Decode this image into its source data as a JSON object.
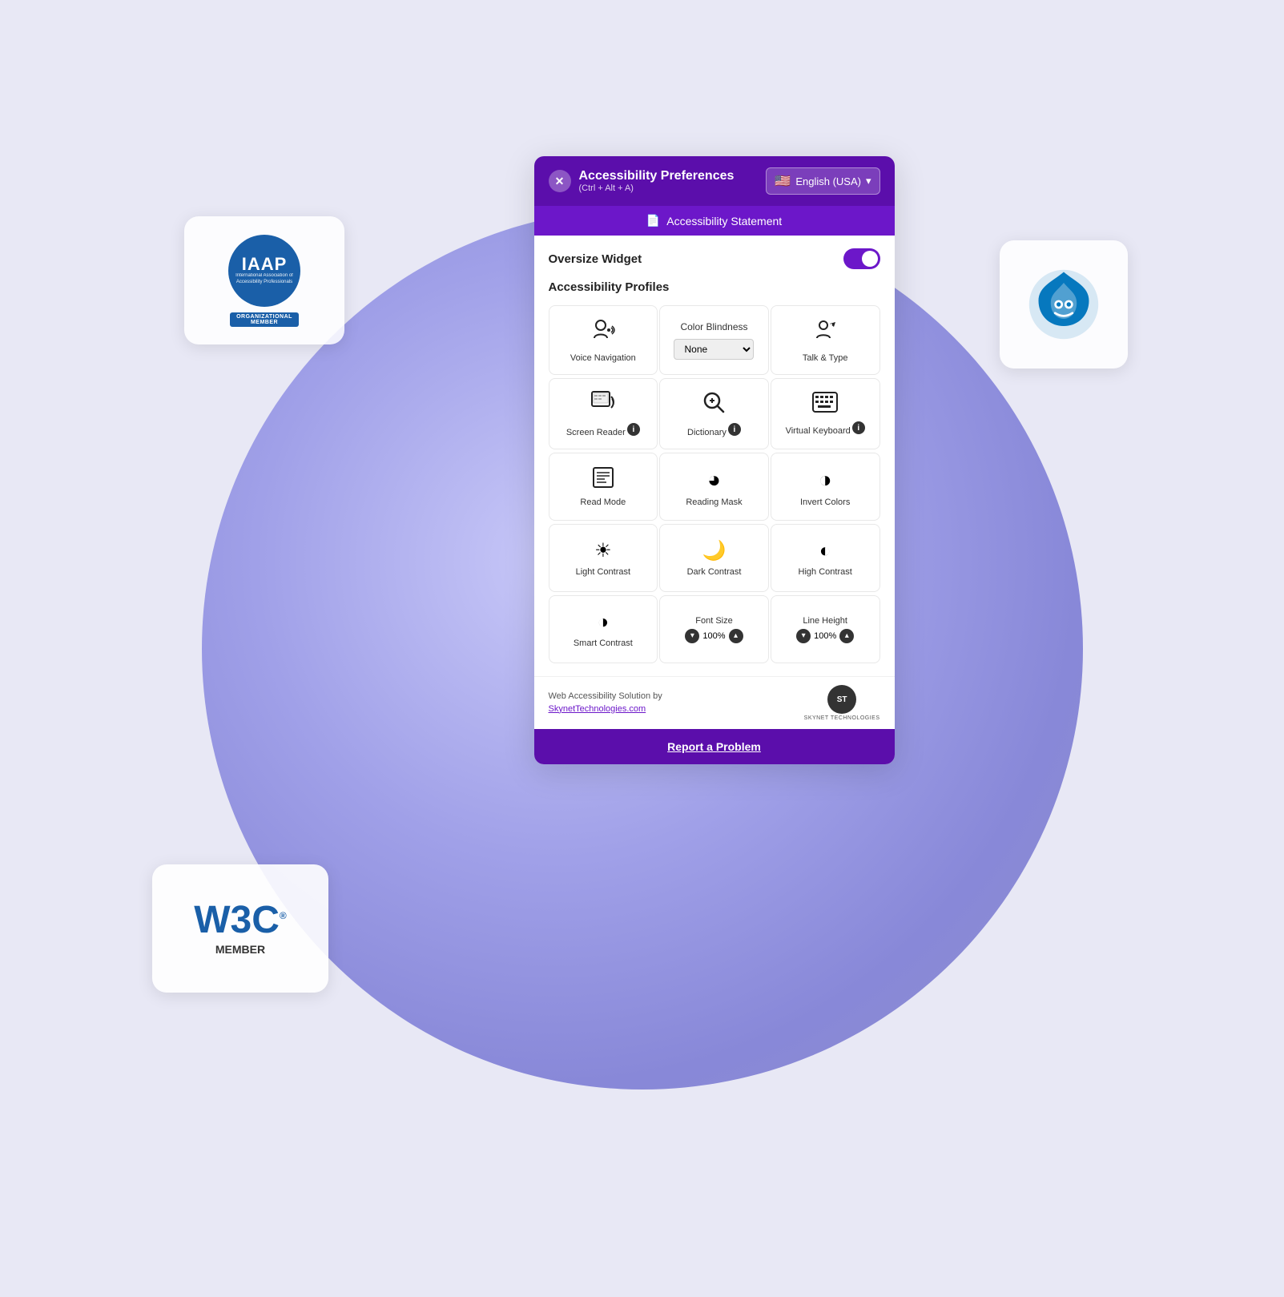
{
  "page": {
    "bg_color": "#e8e8f5"
  },
  "iaap": {
    "title": "IAAP",
    "subtitle": "International Association\nof Accessibility Professionals",
    "org_label": "ORGANIZATIONAL",
    "member_label": "MEMBER"
  },
  "w3c": {
    "logo": "W3C",
    "reg": "®",
    "member": "MEMBER"
  },
  "header": {
    "close_label": "✕",
    "title": "Accessibility Preferences",
    "shortcut": "(Ctrl + Alt + A)",
    "lang": "English (USA)",
    "chevron": "▾"
  },
  "statement_bar": {
    "icon": "📄",
    "label": "Accessibility Statement"
  },
  "oversize": {
    "label": "Oversize Widget"
  },
  "profiles": {
    "section_title": "Accessibility Profiles",
    "items": [
      {
        "id": "voice-navigation",
        "icon": "🗣",
        "label": "Voice Navigation"
      },
      {
        "id": "color-blindness",
        "label": "Color Blindness",
        "has_select": true,
        "select_default": "None"
      },
      {
        "id": "talk-type",
        "icon": "💬",
        "label": "Talk & Type"
      },
      {
        "id": "screen-reader",
        "icon": "🖥",
        "label": "Screen Reader",
        "has_info": true
      },
      {
        "id": "dictionary",
        "icon": "🔍",
        "label": "Dictionary",
        "has_info": true
      },
      {
        "id": "virtual-keyboard",
        "icon": "⌨",
        "label": "Virtual Keyboard",
        "has_info": true
      },
      {
        "id": "read-mode",
        "icon": "📰",
        "label": "Read Mode"
      },
      {
        "id": "reading-mask",
        "icon": "◕",
        "label": "Reading Mask"
      },
      {
        "id": "invert-colors",
        "icon": "◑",
        "label": "Invert Colors"
      },
      {
        "id": "light-contrast",
        "icon": "☀",
        "label": "Light Contrast"
      },
      {
        "id": "dark-contrast",
        "icon": "🌙",
        "label": "Dark Contrast"
      },
      {
        "id": "high-contrast",
        "icon": "◐",
        "label": "High Contrast"
      },
      {
        "id": "smart-contrast",
        "icon": "◑",
        "label": "Smart Contrast"
      },
      {
        "id": "font-size",
        "label": "Font Size",
        "has_stepper": true,
        "value": "100%"
      },
      {
        "id": "line-height",
        "label": "Line Height",
        "has_stepper": true,
        "value": "100%"
      }
    ]
  },
  "footer": {
    "text1": "Web Accessibility Solution by",
    "text2": "SkynetTechnologies.com",
    "logo_text": "ST",
    "logo_sub": "SKYNET TECHNOLOGIES"
  },
  "report": {
    "label": "Report a Problem"
  }
}
